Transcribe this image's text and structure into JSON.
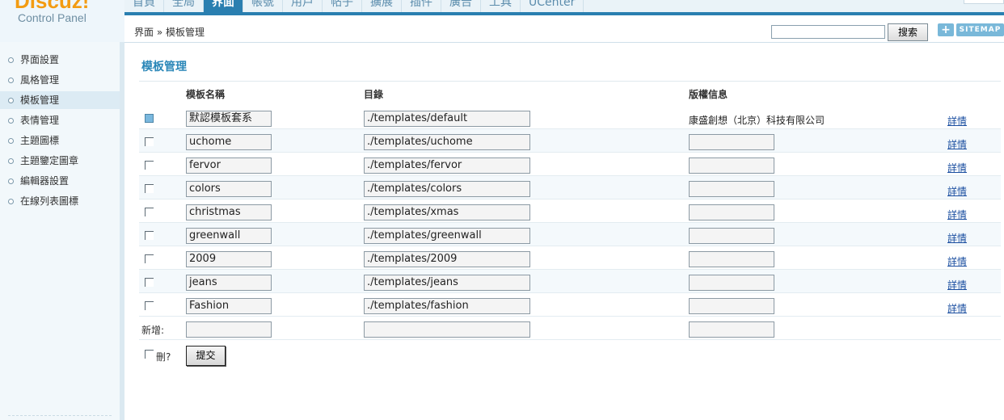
{
  "brand": {
    "logo_text": "Discuz!",
    "subtitle": "Control Panel"
  },
  "nav": {
    "tabs": [
      "首頁",
      "全局",
      "界面",
      "帳號",
      "用戶",
      "帖子",
      "擴展",
      "插件",
      "廣告",
      "工具",
      "UCenter"
    ],
    "active_index": 2
  },
  "breadcrumb": "界面 » 模板管理",
  "search": {
    "button": "搜索",
    "plus": "+",
    "sitemap": "SITEMAP"
  },
  "sidebar": {
    "items": [
      "界面設置",
      "風格管理",
      "模板管理",
      "表情管理",
      "主題圖標",
      "主題鑒定圖章",
      "編輯器設置",
      "在線列表圖標"
    ],
    "active_index": 2
  },
  "page_title": "模板管理",
  "table": {
    "headers": {
      "name": "模板名稱",
      "dir": "目錄",
      "copyright": "版權信息"
    },
    "rows": [
      {
        "checked": true,
        "name": "默認模板套系",
        "dir": "./templates/default",
        "copyright": "康盛創想（北京）科技有限公司",
        "link": "詳情"
      },
      {
        "checked": false,
        "name": "uchome",
        "dir": "./templates/uchome",
        "copyright": "",
        "link": "詳情"
      },
      {
        "checked": false,
        "name": "fervor",
        "dir": "./templates/fervor",
        "copyright": "",
        "link": "詳情"
      },
      {
        "checked": false,
        "name": "colors",
        "dir": "./templates/colors",
        "copyright": "",
        "link": "詳情"
      },
      {
        "checked": false,
        "name": "christmas",
        "dir": "./templates/xmas",
        "copyright": "",
        "link": "詳情"
      },
      {
        "checked": false,
        "name": "greenwall",
        "dir": "./templates/greenwall",
        "copyright": "",
        "link": "詳情"
      },
      {
        "checked": false,
        "name": "2009",
        "dir": "./templates/2009",
        "copyright": "",
        "link": "詳情"
      },
      {
        "checked": false,
        "name": "jeans",
        "dir": "./templates/jeans",
        "copyright": "",
        "link": "詳情"
      },
      {
        "checked": false,
        "name": "Fashion",
        "dir": "./templates/fashion",
        "copyright": "",
        "link": "詳情"
      }
    ],
    "new_label": "新增:"
  },
  "footer": {
    "delete_label": "刪?",
    "submit": "提交"
  },
  "colors": {
    "accent": "#2a7fb0",
    "title": "#2b87b8",
    "link": "#1a4ea0"
  }
}
